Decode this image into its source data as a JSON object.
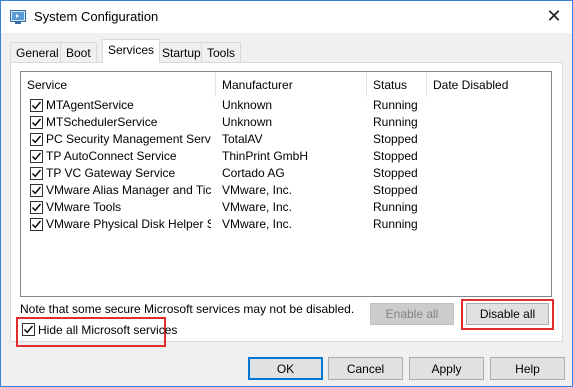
{
  "window": {
    "title": "System Configuration",
    "close_glyph": "✕"
  },
  "tabs": [
    {
      "label": "General",
      "active": false
    },
    {
      "label": "Boot",
      "active": false
    },
    {
      "label": "Services",
      "active": true
    },
    {
      "label": "Startup",
      "active": false
    },
    {
      "label": "Tools",
      "active": false
    }
  ],
  "table": {
    "columns": [
      "Service",
      "Manufacturer",
      "Status",
      "Date Disabled"
    ],
    "rows": [
      {
        "service": "MTAgentService",
        "manufacturer": "Unknown",
        "status": "Running",
        "date_disabled": "",
        "checked": true
      },
      {
        "service": "MTSchedulerService",
        "manufacturer": "Unknown",
        "status": "Running",
        "date_disabled": "",
        "checked": true
      },
      {
        "service": "PC Security Management Service",
        "manufacturer": "TotalAV",
        "status": "Stopped",
        "date_disabled": "",
        "checked": true
      },
      {
        "service": "TP AutoConnect Service",
        "manufacturer": "ThinPrint GmbH",
        "status": "Stopped",
        "date_disabled": "",
        "checked": true
      },
      {
        "service": "TP VC Gateway Service",
        "manufacturer": "Cortado AG",
        "status": "Stopped",
        "date_disabled": "",
        "checked": true
      },
      {
        "service": "VMware Alias Manager and Ticke...",
        "manufacturer": "VMware, Inc.",
        "status": "Stopped",
        "date_disabled": "",
        "checked": true
      },
      {
        "service": "VMware Tools",
        "manufacturer": "VMware, Inc.",
        "status": "Running",
        "date_disabled": "",
        "checked": true
      },
      {
        "service": "VMware Physical Disk Helper Ser...",
        "manufacturer": "VMware, Inc.",
        "status": "Running",
        "date_disabled": "",
        "checked": true
      }
    ]
  },
  "note": "Note that some secure Microsoft services may not be disabled.",
  "buttons": {
    "enable_all": "Enable all",
    "disable_all": "Disable all",
    "ok": "OK",
    "cancel": "Cancel",
    "apply": "Apply",
    "help": "Help"
  },
  "hide_ms": {
    "label": "Hide all Microsoft services",
    "checked": true
  },
  "colors": {
    "highlight": "#e02d2d",
    "accent": "#0078d7"
  },
  "icons": {
    "app": "system-config-icon",
    "checkbox": "check-icon"
  }
}
